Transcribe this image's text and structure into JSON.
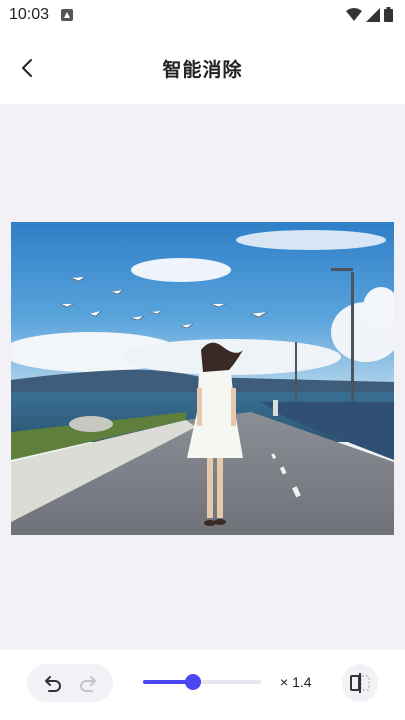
{
  "status_bar": {
    "time": "10:03",
    "notification_icon": "app-notification-icon",
    "icons": [
      "wifi-icon",
      "cellular-signal-icon",
      "battery-icon"
    ]
  },
  "header": {
    "back_icon": "chevron-left-icon",
    "title": "智能消除"
  },
  "photo": {
    "description_icon": "photo-woman-walking-on-seaside-road"
  },
  "toolbar": {
    "undo_icon": "undo-icon",
    "redo_icon": "redo-icon",
    "brush_size_fraction": 0.42,
    "zoom_label": "× 1.4",
    "compare_icon": "compare-icon"
  },
  "colors": {
    "accent": "#4b47f0",
    "canvas_bg": "#f2f2f6"
  }
}
